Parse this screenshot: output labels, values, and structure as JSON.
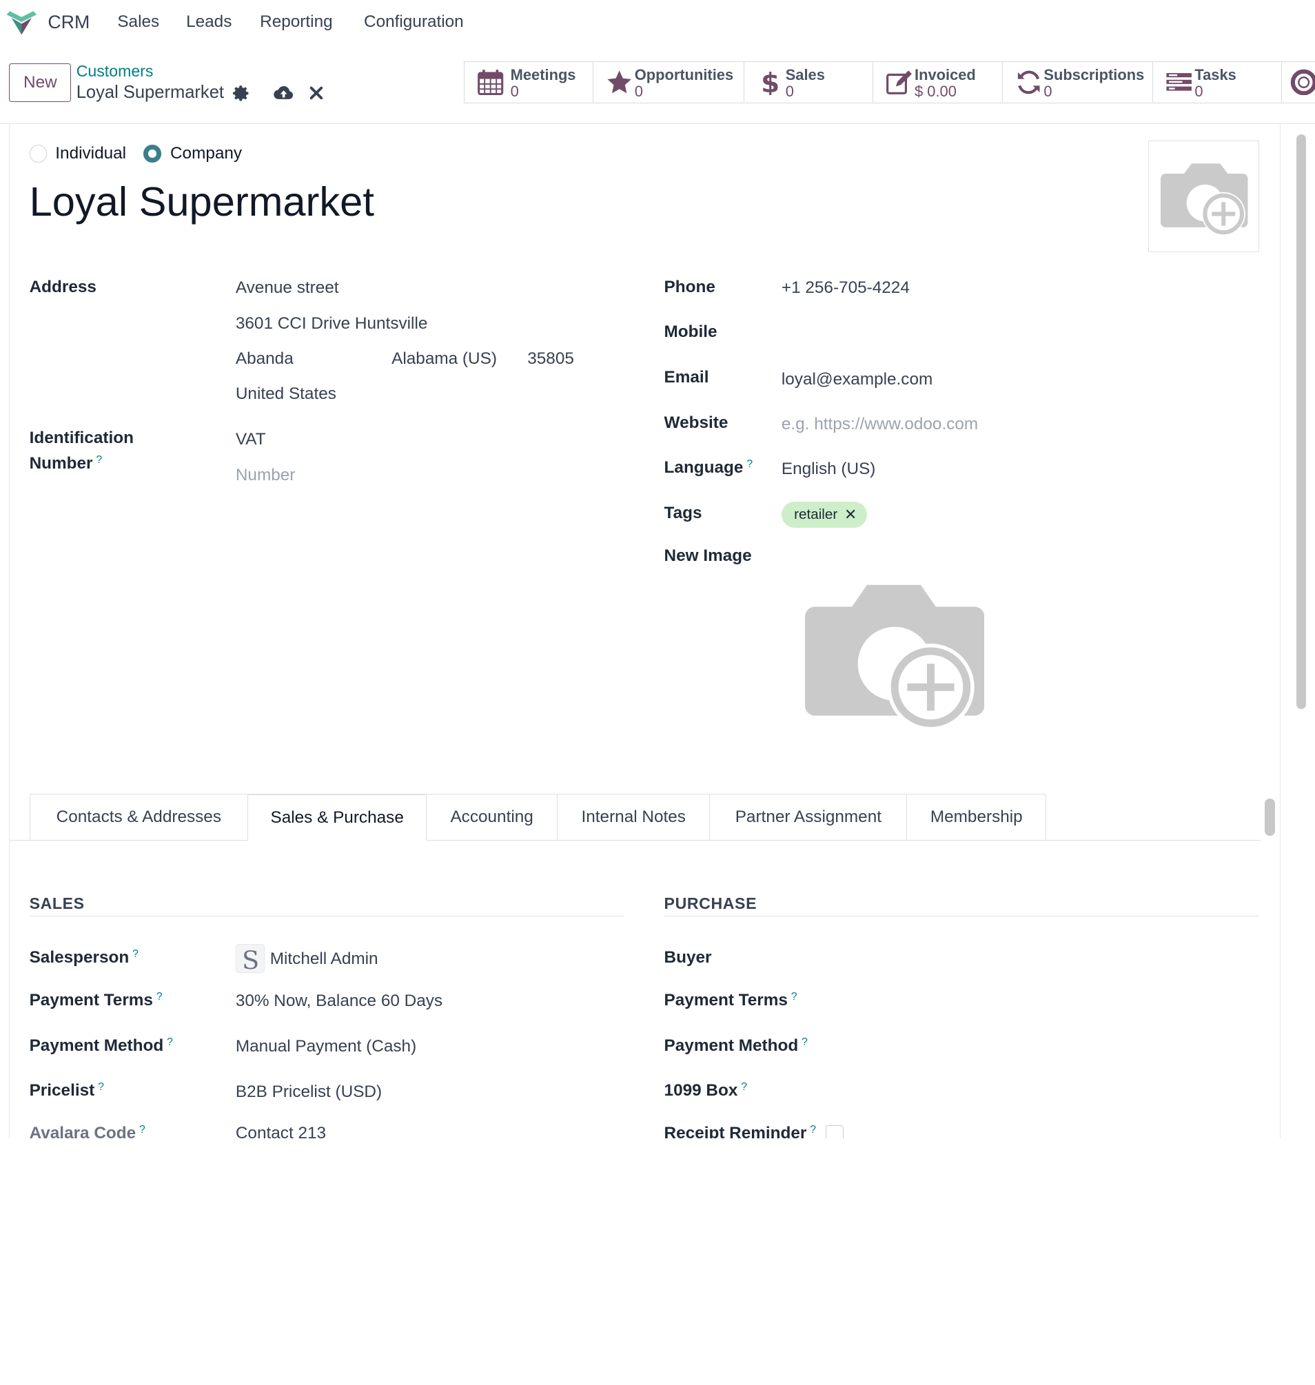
{
  "nav": {
    "app_name": "CRM",
    "menu": [
      "Sales",
      "Leads",
      "Reporting",
      "Configuration"
    ]
  },
  "control_panel": {
    "new_label": "New",
    "breadcrumb_parent": "Customers",
    "breadcrumb_current": "Loyal Supermarket",
    "smart_buttons": [
      {
        "icon": "calendar-icon",
        "label": "Meetings",
        "value": "0"
      },
      {
        "icon": "star-icon",
        "label": "Opportunities",
        "value": "0"
      },
      {
        "icon": "dollar-icon",
        "label": "Sales",
        "value": "0"
      },
      {
        "icon": "invoice-edit-icon",
        "label": "Invoiced",
        "value": "$ 0.00"
      },
      {
        "icon": "refresh-icon",
        "label": "Subscriptions",
        "value": "0"
      },
      {
        "icon": "tasks-icon",
        "label": "Tasks",
        "value": "0"
      }
    ]
  },
  "form": {
    "type_options": {
      "individual": "Individual",
      "company": "Company",
      "selected": "Company"
    },
    "name": "Loyal Supermarket",
    "address_label": "Address",
    "street": "Avenue street",
    "street2": "3601 CCI Drive Huntsville",
    "city": "Abanda",
    "state": "Alabama (US)",
    "zip": "35805",
    "country": "United States",
    "identification_label_1": "Identification",
    "identification_label_2": "Number",
    "id_type": "VAT",
    "id_number_placeholder": "Number",
    "phone_label": "Phone",
    "phone": "+1 256-705-4224",
    "mobile_label": "Mobile",
    "email_label": "Email",
    "email": "loyal@example.com",
    "website_label": "Website",
    "website_placeholder": "e.g. https://www.odoo.com",
    "language_label": "Language",
    "language": "English (US)",
    "tags_label": "Tags",
    "tags": [
      "retailer"
    ],
    "new_image_label": "New Image",
    "help_mark": "?"
  },
  "tabs": [
    {
      "label": "Contacts & Addresses",
      "active": false
    },
    {
      "label": "Sales & Purchase",
      "active": true
    },
    {
      "label": "Accounting",
      "active": false
    },
    {
      "label": "Internal Notes",
      "active": false
    },
    {
      "label": "Partner Assignment",
      "active": false
    },
    {
      "label": "Membership",
      "active": false
    }
  ],
  "sales": {
    "heading": "SALES",
    "salesperson_label": "Salesperson",
    "salesperson": "Mitchell Admin",
    "payment_terms_label": "Payment Terms",
    "payment_terms": "30% Now, Balance 60 Days",
    "payment_method_label": "Payment Method",
    "payment_method": "Manual Payment (Cash)",
    "pricelist_label": "Pricelist",
    "pricelist": "B2B Pricelist (USD)",
    "avalara_label": "Avalara Code",
    "avalara": "Contact 213"
  },
  "purchase": {
    "heading": "PURCHASE",
    "buyer_label": "Buyer",
    "payment_terms_label": "Payment Terms",
    "payment_method_label": "Payment Method",
    "box_1099_label": "1099 Box",
    "receipt_reminder_label": "Receipt Reminder"
  },
  "colors": {
    "brand": "#714b67",
    "link": "#017e84",
    "tag_bg": "#cdeec9"
  }
}
